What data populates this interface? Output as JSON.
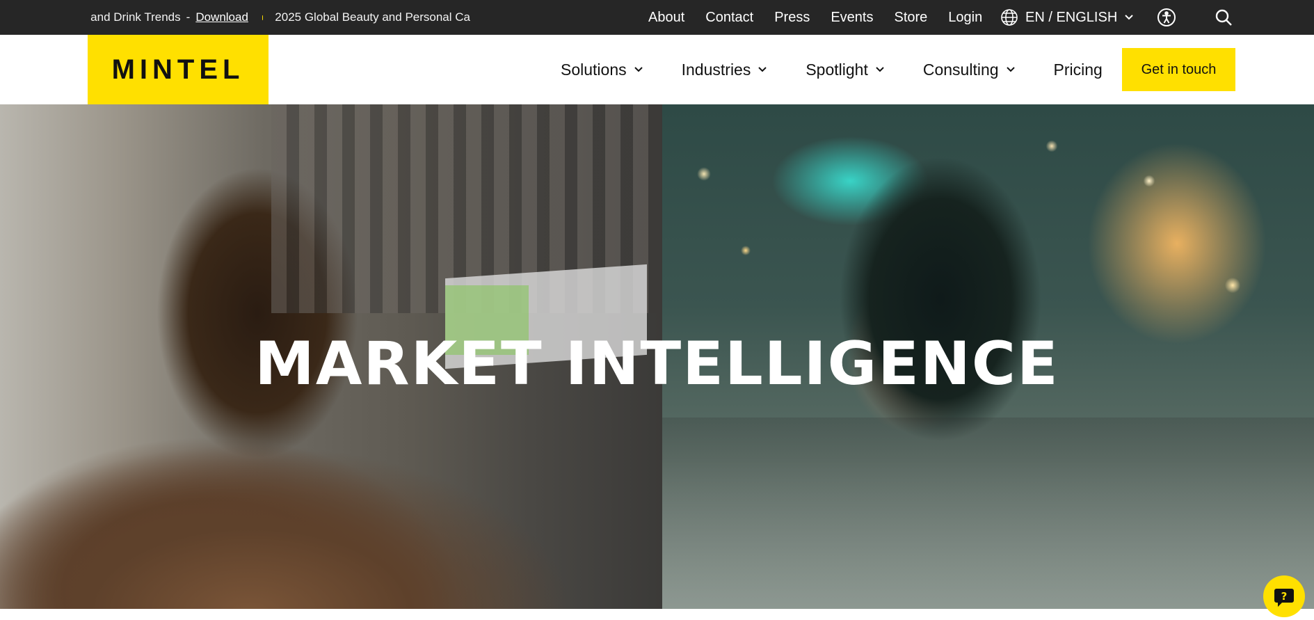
{
  "utility_bar": {
    "ticker": {
      "item1_text": "d and Drink Trends",
      "separator": "-",
      "item1_link": "Download",
      "item2_text": "2025 Global Beauty and Personal Ca"
    },
    "links": [
      "About",
      "Contact",
      "Press",
      "Events",
      "Store",
      "Login"
    ],
    "language": "EN / ENGLISH"
  },
  "header": {
    "logo_text": "MINTEL",
    "nav": [
      {
        "label": "Solutions",
        "dropdown": true
      },
      {
        "label": "Industries",
        "dropdown": true
      },
      {
        "label": "Spotlight",
        "dropdown": true
      },
      {
        "label": "Consulting",
        "dropdown": true
      },
      {
        "label": "Pricing",
        "dropdown": false
      }
    ],
    "cta_label": "Get in touch"
  },
  "hero": {
    "title": "MARKET INTELLIGENCE"
  },
  "colors": {
    "brand_yellow": "#ffe000",
    "topbar_bg": "#262626"
  },
  "icons": [
    "globe-icon",
    "chevron-down-icon",
    "accessibility-icon",
    "search-icon",
    "help-question-icon"
  ]
}
